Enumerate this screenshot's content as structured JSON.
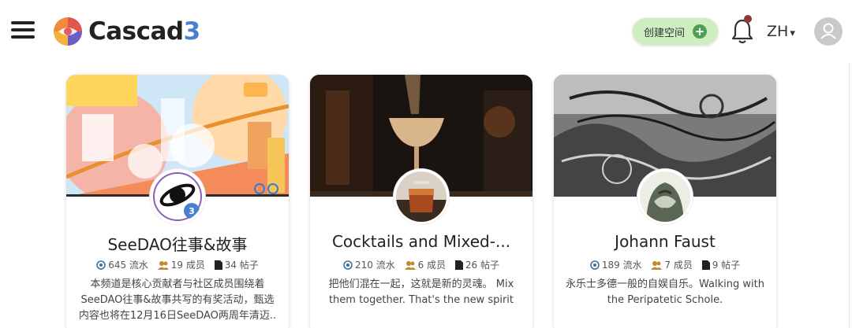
{
  "header": {
    "logo_text_main": "Cascad",
    "logo_text_accent": "3",
    "create_space_label": "创建空间",
    "language": "ZH",
    "language_caret": "▾"
  },
  "icons": {
    "menu": "hamburger-icon",
    "plus": "plus-icon",
    "bell": "bell-icon",
    "user": "user-icon",
    "flow": "flow-icon",
    "members": "members-icon",
    "posts": "document-icon"
  },
  "colors": {
    "create_button_bg": "#cdeec0",
    "plus_circle": "#4f9d57",
    "notification_dot": "#8b3a3a",
    "stat_icon_flow": "#3e6f9e",
    "stat_icon_members": "#c08a30"
  },
  "cards": [
    {
      "title": "SeeDAO往事&故事",
      "flow_value": "645 流水",
      "members_value": "19 成员",
      "posts_value": "34 帖子",
      "description": "本频道是核心贡献者与社区成员围绕着SeeDAO往事&故事共写的有奖活动，甄选内容也将在12月16日SeeDAO两周年清迈.."
    },
    {
      "title": "Cocktails and Mixed-...",
      "flow_value": "210 流水",
      "members_value": "6 成员",
      "posts_value": "26 帖子",
      "description": "把他们混在一起，这就是新的灵魂。 Mix them together. That's the new spirit"
    },
    {
      "title": "Johann Faust",
      "flow_value": "189 流水",
      "members_value": "7 成员",
      "posts_value": "9 帖子",
      "description": "永乐士多德一般的自娱自乐。Walking with the Peripatetic Schole."
    }
  ]
}
